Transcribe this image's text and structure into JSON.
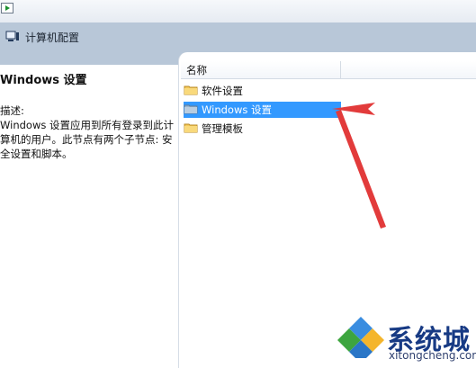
{
  "window": {
    "title": "计算机配置"
  },
  "left": {
    "heading": "Windows 设置",
    "description_label": "描述:",
    "description_line1": "Windows 设置应用到所有登录到此计",
    "description_line2": "算机的用户。此节点有两个子节点: 安",
    "description_line3": "全设置和脚本。"
  },
  "list": {
    "column_header": "名称",
    "items": [
      {
        "label": "软件设置",
        "icon": "folder-icon",
        "selected": false
      },
      {
        "label": "Windows 设置",
        "icon": "folder-icon",
        "selected": true
      },
      {
        "label": "管理模板",
        "icon": "folder-icon",
        "selected": false
      }
    ]
  },
  "colors": {
    "band": "#b8c7d8",
    "selection": "#3399ff",
    "annotation_arrow": "#e23b3b"
  },
  "watermark": {
    "brand": "系统城",
    "url": "xitongcheng.com"
  }
}
